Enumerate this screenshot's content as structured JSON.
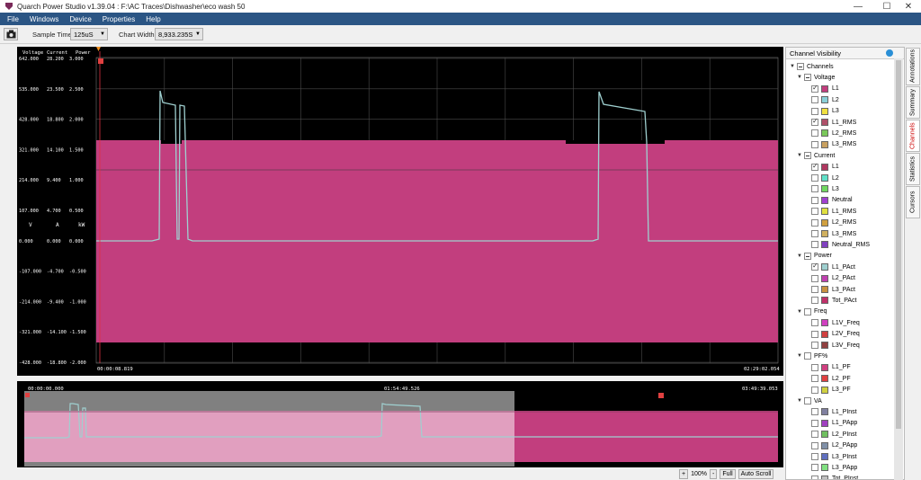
{
  "window": {
    "title": "Quarch Power Studio v1.39.04 : F:\\AC Traces\\Dishwasher\\eco wash 50",
    "minimize": "—",
    "maximize": "☐",
    "close": "✕"
  },
  "menu": [
    "File",
    "Windows",
    "Device",
    "Properties",
    "Help"
  ],
  "toolbar": {
    "sample_time_label": "Sample Time:",
    "sample_time_value": "125uS",
    "chart_width_label": "Chart Width:",
    "chart_width_value": "8,933.235S"
  },
  "chart": {
    "axis_headers": [
      "Voltage",
      "Current",
      "Power"
    ],
    "voltage_ticks": [
      "642.000",
      "535.000",
      "428.000",
      "321.000",
      "214.000",
      "107.000",
      "0.000",
      "-107.000",
      "-214.000",
      "-321.000",
      "-428.000"
    ],
    "current_ticks": [
      "28.200",
      "23.500",
      "18.800",
      "14.100",
      "9.400",
      "4.700",
      "0.000",
      "-4.700",
      "-9.400",
      "-14.100",
      "-18.800"
    ],
    "power_ticks": [
      "3.000",
      "2.500",
      "2.000",
      "1.500",
      "1.000",
      "0.500",
      "0.000",
      "-0.500",
      "-1.000",
      "-1.500",
      "-2.000"
    ],
    "units": [
      "V",
      "A",
      "kW"
    ],
    "start_time": "00:00:08.819",
    "end_time": "02:29:02.054",
    "colors": {
      "voltage": "#c23e7e",
      "power": "#9fd0d0",
      "rms": "#7a3a5a",
      "grid": "#555555"
    }
  },
  "overview": {
    "start_time": "00:00:00.000",
    "mid_time": "01:54:49.526",
    "end_time": "03:49:39.053"
  },
  "zoom": {
    "zoom_in": "+",
    "level": "100%",
    "zoom_out": "-",
    "full": "Full",
    "auto_scroll": "Auto Scroll"
  },
  "panel": {
    "title": "Channel Visibility",
    "tabs": [
      "Annotations",
      "Summary",
      "Channels",
      "Statistics",
      "Cursors"
    ],
    "tree": [
      {
        "label": "Channels",
        "level": 0,
        "type": "group",
        "state": "mixed"
      },
      {
        "label": "Voltage",
        "level": 1,
        "type": "group",
        "state": "mixed"
      },
      {
        "label": "L1",
        "level": 2,
        "state": "on",
        "color": "#c23e7e"
      },
      {
        "label": "L2",
        "level": 2,
        "state": "off",
        "color": "#8ad0d8"
      },
      {
        "label": "L3",
        "level": 2,
        "state": "off",
        "color": "#f0e040"
      },
      {
        "label": "L1_RMS",
        "level": 2,
        "state": "on",
        "color": "#b0506a"
      },
      {
        "label": "L2_RMS",
        "level": 2,
        "state": "off",
        "color": "#7ac85a"
      },
      {
        "label": "L3_RMS",
        "level": 2,
        "state": "off",
        "color": "#c8a060"
      },
      {
        "label": "Current",
        "level": 1,
        "type": "group",
        "state": "mixed"
      },
      {
        "label": "L1",
        "level": 2,
        "state": "on",
        "color": "#b03860"
      },
      {
        "label": "L2",
        "level": 2,
        "state": "off",
        "color": "#60e0c8"
      },
      {
        "label": "L3",
        "level": 2,
        "state": "off",
        "color": "#70d860"
      },
      {
        "label": "Neutral",
        "level": 2,
        "state": "off",
        "color": "#a040d0"
      },
      {
        "label": "L1_RMS",
        "level": 2,
        "state": "off",
        "color": "#e0e040"
      },
      {
        "label": "L2_RMS",
        "level": 2,
        "state": "off",
        "color": "#d0a040"
      },
      {
        "label": "L3_RMS",
        "level": 2,
        "state": "off",
        "color": "#d0b060"
      },
      {
        "label": "Neutral_RMS",
        "level": 2,
        "state": "off",
        "color": "#8040c0"
      },
      {
        "label": "Power",
        "level": 1,
        "type": "group",
        "state": "mixed"
      },
      {
        "label": "L1_PAct",
        "level": 2,
        "state": "on",
        "color": "#9fd0d0"
      },
      {
        "label": "L2_PAct",
        "level": 2,
        "state": "off",
        "color": "#c040b0"
      },
      {
        "label": "L3_PAct",
        "level": 2,
        "state": "off",
        "color": "#c89040"
      },
      {
        "label": "Tot_PAct",
        "level": 2,
        "state": "off",
        "color": "#c0306a"
      },
      {
        "label": "Freq",
        "level": 1,
        "type": "group",
        "state": "off"
      },
      {
        "label": "L1V_Freq",
        "level": 2,
        "state": "off",
        "color": "#d040c0"
      },
      {
        "label": "L2V_Freq",
        "level": 2,
        "state": "off",
        "color": "#d04040"
      },
      {
        "label": "L3V_Freq",
        "level": 2,
        "state": "off",
        "color": "#904040"
      },
      {
        "label": "PF%",
        "level": 1,
        "type": "group",
        "state": "off"
      },
      {
        "label": "L1_PF",
        "level": 2,
        "state": "off",
        "color": "#d04080"
      },
      {
        "label": "L2_PF",
        "level": 2,
        "state": "off",
        "color": "#e04040"
      },
      {
        "label": "L3_PF",
        "level": 2,
        "state": "off",
        "color": "#d0d040"
      },
      {
        "label": "VA",
        "level": 1,
        "type": "group",
        "state": "off"
      },
      {
        "label": "L1_PInst",
        "level": 2,
        "state": "off",
        "color": "#8080a0"
      },
      {
        "label": "L1_PApp",
        "level": 2,
        "state": "off",
        "color": "#a040c0"
      },
      {
        "label": "L2_PInst",
        "level": 2,
        "state": "off",
        "color": "#70c060"
      },
      {
        "label": "L2_PApp",
        "level": 2,
        "state": "off",
        "color": "#8090a8"
      },
      {
        "label": "L3_PInst",
        "level": 2,
        "state": "off",
        "color": "#6070c0"
      },
      {
        "label": "L3_PApp",
        "level": 2,
        "state": "off",
        "color": "#80e080"
      },
      {
        "label": "Tot_PInst",
        "level": 2,
        "state": "off",
        "color": "#c0c0c0"
      }
    ]
  }
}
